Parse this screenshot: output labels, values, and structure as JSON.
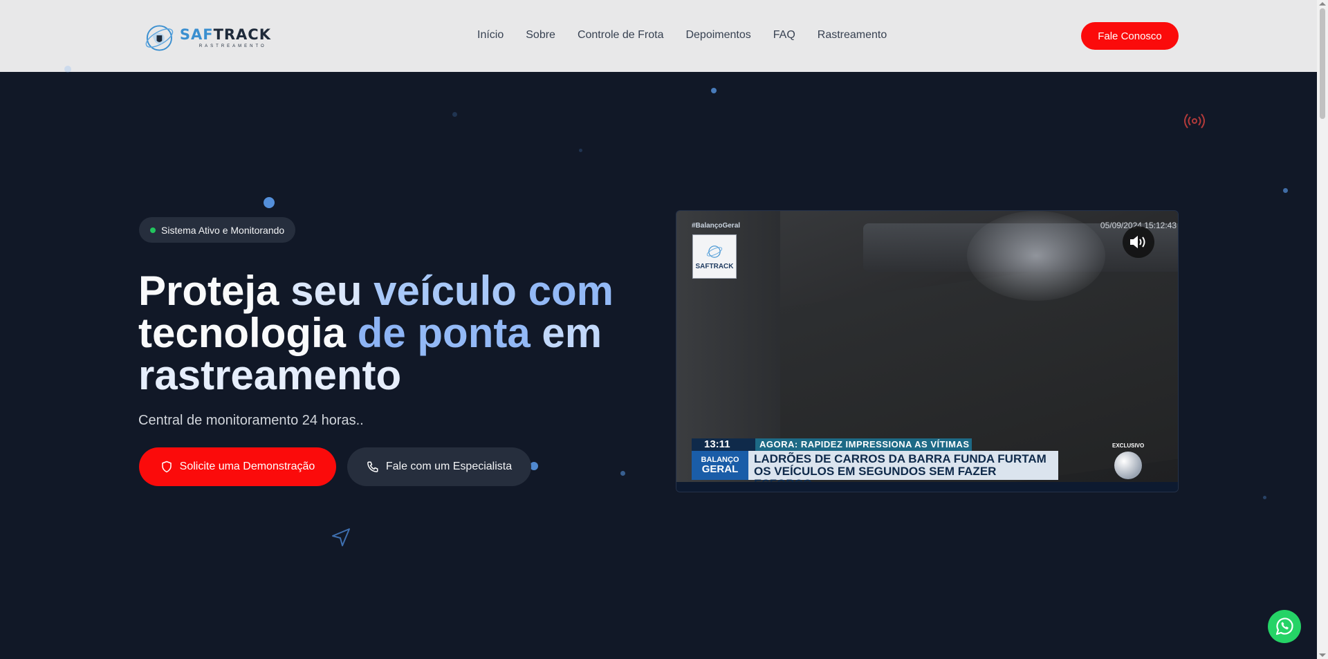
{
  "header": {
    "logo": {
      "brand_primary": "SAF",
      "brand_secondary": "TRACK",
      "tagline": "RASTREAMENTO"
    },
    "nav": [
      {
        "label": "Início"
      },
      {
        "label": "Sobre"
      },
      {
        "label": "Controle de Frota"
      },
      {
        "label": "Depoimentos"
      },
      {
        "label": "FAQ"
      },
      {
        "label": "Rastreamento"
      }
    ],
    "cta_label": "Fale Conosco"
  },
  "hero": {
    "badge": "Sistema Ativo e Monitorando",
    "title_words": [
      "Proteja",
      "seu",
      "veículo",
      "com",
      "tecnologia",
      "de",
      "ponta",
      "em",
      "rastreamento"
    ],
    "subtitle": "Central de monitoramento 24 horas..",
    "btn_demo": "Solicite uma Demonstração",
    "btn_expert": "Fale com um Especialista"
  },
  "video": {
    "hashtag": "#BalançoGeral",
    "date_overlay": "05/09/2024 15:12:43",
    "logo_text": "SAFTRACK",
    "time": "13:11",
    "headline": "AGORA: RAPIDEZ IMPRESSIONA AS VÍTIMAS",
    "brand_top": "BALANÇO",
    "brand_bottom": "GERAL",
    "text_line1": "LADRÕES DE CARROS DA BARRA FUNDA FURTAM",
    "text_line2": "OS VEÍCULOS EM SEGUNDOS SEM FAZER ESFORÇO",
    "exclusive": "EXCLUSIVO"
  },
  "colors": {
    "background": "#111827",
    "header_bg": "#e8e8e9",
    "brand_red": "#fb0b0b",
    "accent_blue": "#60a5fa",
    "status_green": "#22c55e",
    "whatsapp_green": "#25d366"
  },
  "icons": {
    "logo": "globe-shield-icon",
    "badge": "status-dot",
    "demo_button": "shield-icon",
    "expert_button": "phone-icon",
    "video_volume": "volume-icon",
    "decor_top_right": "signal-icon",
    "decor_bottom_left": "send-icon",
    "floating": "whatsapp-icon"
  }
}
